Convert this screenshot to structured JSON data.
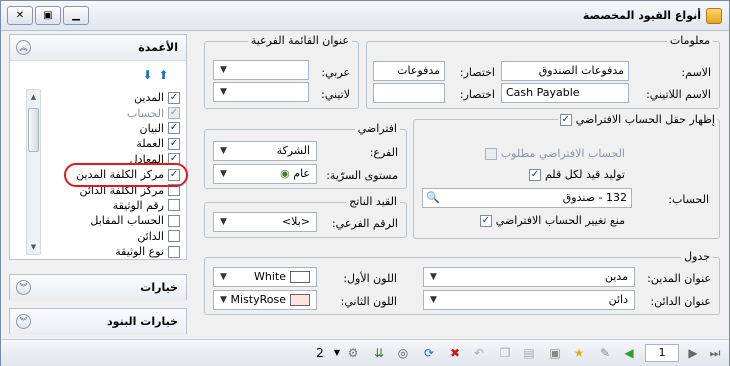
{
  "window": {
    "title": "أنواع القيود المخصصة"
  },
  "sidebar": {
    "columns_title": "الأعمدة",
    "columns": [
      {
        "label": "المدين",
        "checked": true,
        "disabled": false
      },
      {
        "label": "الحساب",
        "checked": true,
        "disabled": true
      },
      {
        "label": "البيان",
        "checked": true,
        "disabled": false
      },
      {
        "label": "العملة",
        "checked": true,
        "disabled": false
      },
      {
        "label": "المعادل",
        "checked": true,
        "disabled": false
      },
      {
        "label": "مركز الكلفة المدين",
        "checked": true,
        "disabled": false
      },
      {
        "label": "مركز الكلفة الدائن",
        "checked": false,
        "disabled": false
      },
      {
        "label": "رقم الوثيقة",
        "checked": false,
        "disabled": false
      },
      {
        "label": "الحساب المقابل",
        "checked": false,
        "disabled": false
      },
      {
        "label": "الدائن",
        "checked": false,
        "disabled": false
      },
      {
        "label": "نوع الوثيقة",
        "checked": false,
        "disabled": false
      }
    ],
    "options_title": "خيارات",
    "item_options_title": "خيارات البنود"
  },
  "info": {
    "title": "معلومات",
    "name_label": "الاسم:",
    "name_value": "مدفوعات الصندوق",
    "abbr_label": "اختصار:",
    "abbr_value": "مدفوعات",
    "latin_name_label": "الاسم اللاتيني:",
    "latin_name_value": "Cash Payable",
    "latin_abbr_label": "اختصار:",
    "latin_abbr_value": ""
  },
  "subtitle": {
    "title": "عنوان القائمة الفرعية",
    "arabic_label": "عربي:",
    "arabic_value": "",
    "latin_label": "لاتيني:",
    "latin_value": ""
  },
  "default_account": {
    "show_label": "إظهار حقل الحساب الافتراضي",
    "show_checked": true,
    "required_label": "الحساب الافتراضي مطلوب",
    "required_checked": false,
    "per_pen_label": "توليد قيد لكل قلم",
    "per_pen_checked": true,
    "account_label": "الحساب:",
    "account_value": "132 - صندوق",
    "prevent_label": "منع تغيير الحساب الافتراضي",
    "prevent_checked": true
  },
  "defaults": {
    "title": "افتراضي",
    "branch_label": "الفرع:",
    "branch_value": "الشركة",
    "secrecy_label": "مستوى السرّية:",
    "secrecy_value": "عام"
  },
  "result_entry": {
    "title": "القيد الناتج",
    "sub_number_label": "الرقم الفرعي:",
    "sub_number_value": "<بلا>"
  },
  "table": {
    "title": "جدول",
    "debit_title_label": "عنوان المدين:",
    "debit_title_value": "مدين",
    "credit_title_label": "عنوان الدائن:",
    "credit_title_value": "دائن",
    "color1_label": "اللون الأول:",
    "color1_value": "White",
    "color1_hex": "#ffffff",
    "color2_label": "اللون الثاني:",
    "color2_value": "MistyRose",
    "color2_hex": "#ffe4e1"
  },
  "pager": {
    "current": "1",
    "count": "2"
  }
}
